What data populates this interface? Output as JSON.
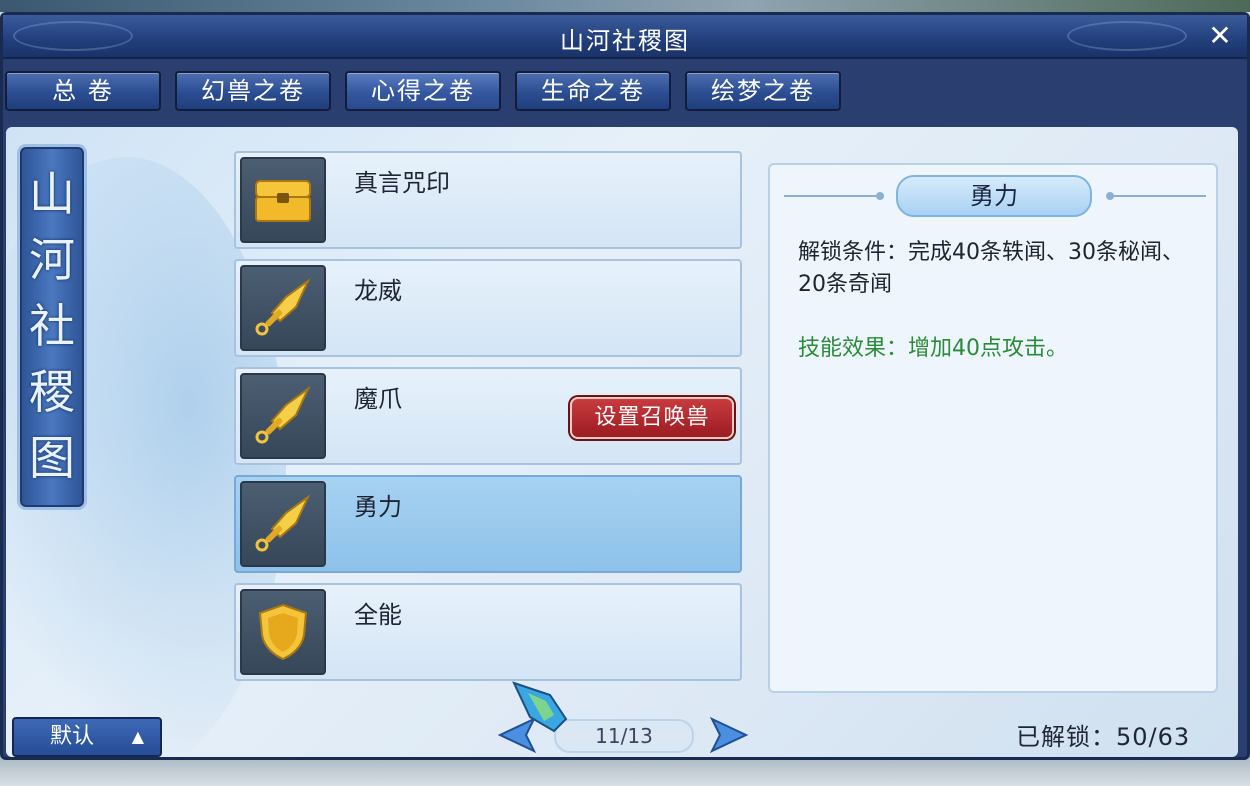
{
  "window": {
    "title": "山河社稷图",
    "close_label": "✕"
  },
  "tabs": [
    {
      "label": "总 卷"
    },
    {
      "label": "幻兽之卷"
    },
    {
      "label": "心得之卷"
    },
    {
      "label": "生命之卷"
    },
    {
      "label": "绘梦之卷"
    }
  ],
  "scroll_title": [
    "山",
    "河",
    "社",
    "稷",
    "图"
  ],
  "list": [
    {
      "label": "真言咒印",
      "icon": "treasure-chest-icon"
    },
    {
      "label": "龙威",
      "icon": "sword-icon"
    },
    {
      "label": "魔爪",
      "icon": "sword-icon",
      "action_label": "设置召唤兽"
    },
    {
      "label": "勇力",
      "icon": "sword-icon",
      "selected": true
    },
    {
      "label": "全能",
      "icon": "shield-icon"
    }
  ],
  "detail": {
    "header": "勇力",
    "unlock_condition": "解锁条件：完成40条轶闻、30条秘闻、20条奇闻",
    "skill_effect": "技能效果：增加40点攻击。"
  },
  "footer": {
    "default_label": "默认",
    "default_arrow": "▲",
    "page": "11/13",
    "unlocked": "已解锁：50/63"
  },
  "colors": {
    "accent": "#2b4d92",
    "selected": "#8dc2ea",
    "effect_text": "#2a8b3b",
    "action_button": "#9b1c22"
  }
}
